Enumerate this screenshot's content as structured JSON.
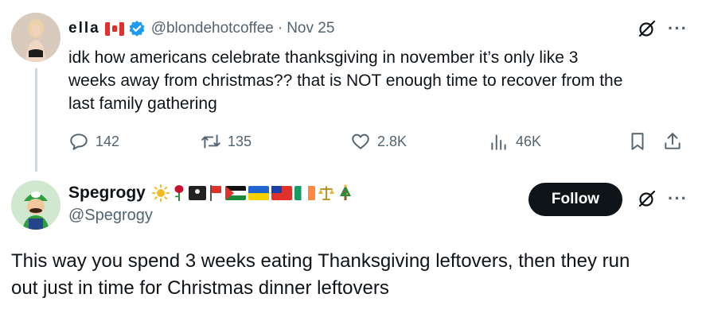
{
  "tweet": {
    "author": {
      "display_name": "ella",
      "flag_emoji": "canada-flag",
      "verified": true,
      "handle": "@blondehotcoffee",
      "date": "Nov 25"
    },
    "text": "idk how americans celebrate thanksgiving in november it’s only like 3\nweeks away from christmas?? that is NOT enough time to recover from the\nlast family gathering",
    "stats": {
      "replies": "142",
      "retweets": "135",
      "likes": "2.8K",
      "views": "46K"
    },
    "icons": [
      "grok-icon",
      "more-icon",
      "reply-icon",
      "retweet-icon",
      "like-icon",
      "views-icon",
      "bookmark-icon",
      "share-icon"
    ]
  },
  "reply": {
    "author": {
      "display_name": "Spegrogy",
      "emojis": [
        "sun",
        "rose",
        "pirate-flag",
        "red-flag",
        "palestine-flag",
        "ukraine-flag",
        "taiwan-flag",
        "ireland-flag",
        "balance-scale",
        "christmas-tree"
      ],
      "handle": "@Spegrogy"
    },
    "follow_label": "Follow",
    "text": "This way you spend 3 weeks eating Thanksgiving leftovers, then they run\nout just in time for Christmas dinner leftovers"
  },
  "colors": {
    "text": "#0f1419",
    "muted": "#536471",
    "verified": "#1d9bf0",
    "button_bg": "#0f1419",
    "thread_line": "#cfd9de"
  }
}
